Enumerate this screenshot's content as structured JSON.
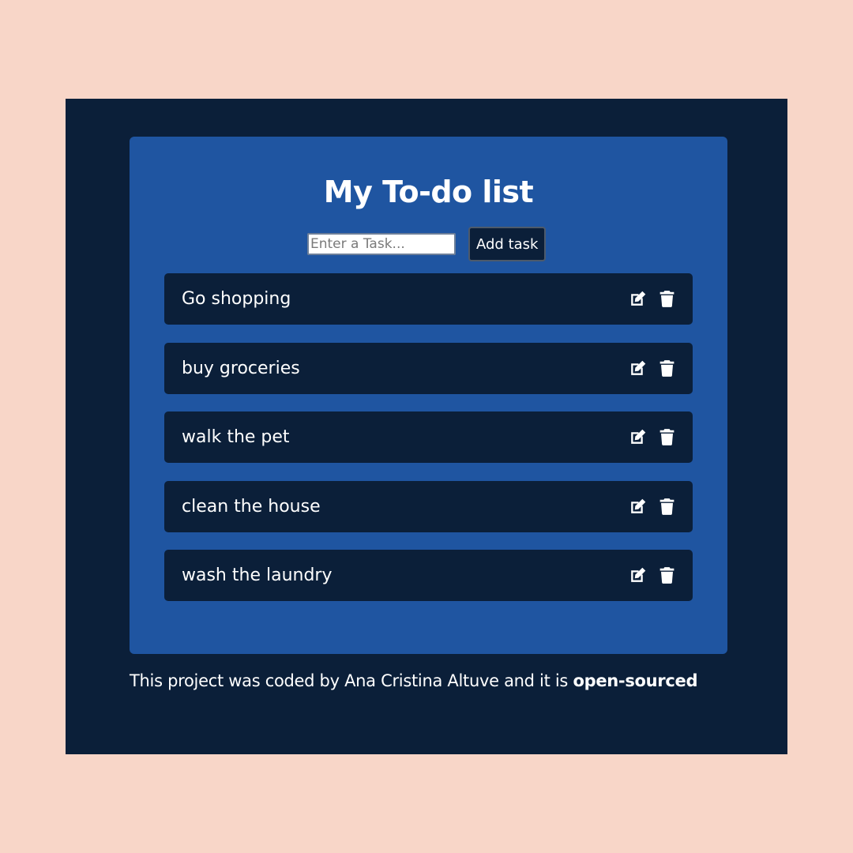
{
  "app": {
    "title": "My To-do list"
  },
  "add_form": {
    "input_placeholder": "Enter a Task...",
    "input_value": "",
    "button_label": "Add task"
  },
  "tasks": [
    {
      "text": "Go shopping",
      "edit_icon": "edit-icon",
      "delete_icon": "trash-icon"
    },
    {
      "text": "buy groceries",
      "edit_icon": "edit-icon",
      "delete_icon": "trash-icon"
    },
    {
      "text": "walk the pet",
      "edit_icon": "edit-icon",
      "delete_icon": "trash-icon"
    },
    {
      "text": "clean the house",
      "edit_icon": "edit-icon",
      "delete_icon": "trash-icon"
    },
    {
      "text": "wash the laundry",
      "edit_icon": "edit-icon",
      "delete_icon": "trash-icon"
    }
  ],
  "footer": {
    "text": "This project was coded by Ana Cristina Altuve and it is ",
    "link_text": "open-sourced"
  },
  "colors": {
    "background": "#f8d6c8",
    "frame": "#0b1f39",
    "card": "#1f55a1",
    "task_bg": "#0b1f39",
    "text": "#ffffff"
  }
}
